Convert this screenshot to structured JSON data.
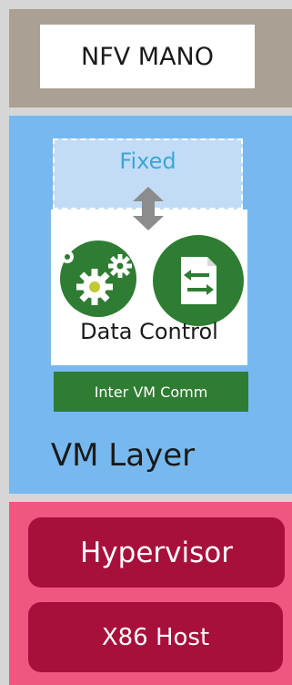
{
  "mano": {
    "label": "NFV MANO"
  },
  "vm_layer": {
    "fixed_label": "Fixed",
    "data_control_label": "Data Control",
    "inter_vm_label": "Inter VM Comm",
    "layer_label": "VM Layer",
    "icons": [
      "gears-icon",
      "transfer-document-icon",
      "up-down-arrow-icon"
    ]
  },
  "hypervisor": {
    "label": "Hypervisor"
  },
  "host": {
    "label": "X86 Host"
  },
  "colors": {
    "background": "#d6d6d6",
    "mano_band": "#aba094",
    "vm_band": "#77b9ee",
    "fixed_fill": "#c3dcf6",
    "fixed_text": "#3aa6d9",
    "green": "#2e7d32",
    "hyp_band": "#ef5680",
    "hyp_box": "#a8103c"
  }
}
